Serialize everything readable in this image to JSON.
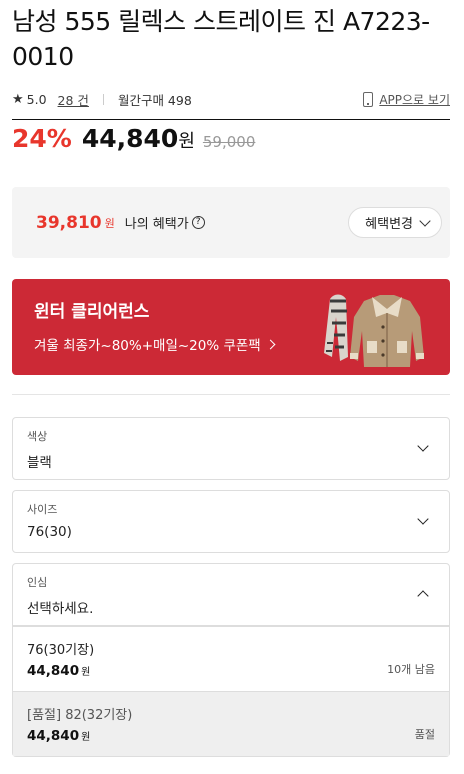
{
  "product": {
    "title": "남성 555 릴렉스 스트레이트 진 A7223-0010",
    "rating": "5.0",
    "reviews": "28 건",
    "monthly_sales": "월간구매 498",
    "app_link": "APP으로 보기"
  },
  "price": {
    "discount": "24%",
    "sale": "44,840",
    "won": "원",
    "original": "59,000"
  },
  "benefit": {
    "price": "39,810",
    "won": "원",
    "label": "나의 혜택가",
    "help": "?",
    "change_button": "혜택변경"
  },
  "banner": {
    "title": "윈터 클리어런스",
    "subtitle": "겨울 최종가~80%+매일~20% 쿠폰팩",
    "image": "coat-and-scarf"
  },
  "options": {
    "color": {
      "label": "색상",
      "value": "블랙"
    },
    "size": {
      "label": "사이즈",
      "value": "76(30)"
    },
    "inseam": {
      "label": "인심",
      "placeholder": "선택하세요.",
      "items": [
        {
          "name": "76(30기장)",
          "price": "44,840",
          "won": "원",
          "status": "10개 남음"
        },
        {
          "name": "[품절] 82(32기장)",
          "price": "44,840",
          "won": "원",
          "status": "품절"
        }
      ]
    }
  },
  "colors": {
    "accent": "#e8362c",
    "banner": "#cc2936"
  }
}
